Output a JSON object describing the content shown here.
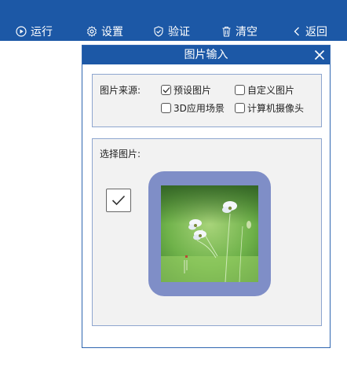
{
  "toolbar": {
    "run_label": "运行",
    "settings_label": "设置",
    "verify_label": "验证",
    "clear_label": "清空",
    "back_label": "返回"
  },
  "dialog": {
    "title": "图片输入",
    "source": {
      "label": "图片来源:",
      "options": [
        {
          "label": "预设图片",
          "checked": true
        },
        {
          "label": "自定义图片",
          "checked": false
        },
        {
          "label": "3D应用场景",
          "checked": false
        },
        {
          "label": "计算机摄像头",
          "checked": false
        }
      ]
    },
    "select": {
      "label": "选择图片:",
      "image_checked": true
    }
  },
  "colors": {
    "primary": "#1c58a6",
    "frame": "#7f8ec7",
    "panel": "#f2f2f2",
    "panel_border": "#8ea6cf"
  }
}
